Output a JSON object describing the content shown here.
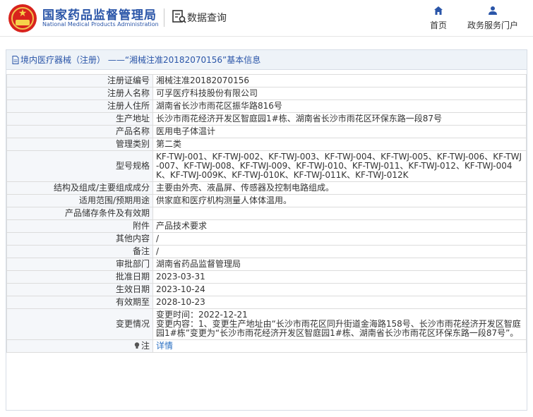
{
  "header": {
    "brand_cn": "国家药品监督管理局",
    "brand_en": "National Medical Products Administration",
    "query_label": "数据查询",
    "nav_home": "首页",
    "nav_gov": "政务服务门户",
    "accent_color": "#2a55a8"
  },
  "panel": {
    "title": "境内医疗器械（注册） ——“湘械注准20182070156”基本信息"
  },
  "rows": [
    {
      "label": "注册证编号",
      "value": "湘械注准20182070156"
    },
    {
      "label": "注册人名称",
      "value": "可孚医疗科技股份有限公司"
    },
    {
      "label": "注册人住所",
      "value": "湖南省长沙市雨花区振华路816号"
    },
    {
      "label": "生产地址",
      "value": "长沙市雨花经济开发区智庭园1#栋、湖南省长沙市雨花区环保东路一段87号"
    },
    {
      "label": "产品名称",
      "value": "医用电子体温计"
    },
    {
      "label": "管理类别",
      "value": "第二类"
    },
    {
      "label": "型号规格",
      "value": "KF-TWJ-001、KF-TWJ-002、KF-TWJ-003、KF-TWJ-004、KF-TWJ-005、KF-TWJ-006、KF-TWJ-007、KF-TWJ-008、KF-TWJ-009、KF-TWJ-010、KF-TWJ-011、KF-TWJ-012、KF-TWJ-004K、KF-TWJ-009K、KF-TWJ-010K、KF-TWJ-011K、KF-TWJ-012K"
    },
    {
      "label": "结构及组成/主要组成成分",
      "value": "主要由外壳、液晶屏、传感器及控制电路组成。"
    },
    {
      "label": "适用范围/预期用途",
      "value": "供家庭和医疗机构测量人体体温用。"
    },
    {
      "label": "产品储存条件及有效期",
      "value": ""
    },
    {
      "label": "附件",
      "value": "产品技术要求"
    },
    {
      "label": "其他内容",
      "value": "/"
    },
    {
      "label": "备注",
      "value": "/"
    },
    {
      "label": "审批部门",
      "value": "湖南省药品监督管理局"
    },
    {
      "label": "批准日期",
      "value": "2023-03-31"
    },
    {
      "label": "生效日期",
      "value": "2023-10-24"
    },
    {
      "label": "有效期至",
      "value": "2028-10-23"
    }
  ],
  "change": {
    "label": "变更情况",
    "time": "变更时间：2022-12-21",
    "content": "变更内容：1、变更生产地址由“长沙市雨花区同升街道金海路158号、长沙市雨花经济开发区智庭园1#栋”变更为“长沙市雨花经济开发区智庭园1#栋、湖南省长沙市雨花区环保东路一段87号”。"
  },
  "note": {
    "label": "注",
    "link": "详情"
  }
}
